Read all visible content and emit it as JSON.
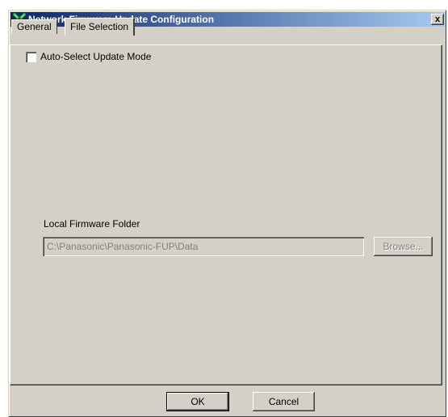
{
  "window": {
    "title": "Network Firmware Update Configuration",
    "icon": "app-icon",
    "close_label": "x"
  },
  "tabs": [
    {
      "label": "General",
      "active": false
    },
    {
      "label": "File Selection",
      "active": true
    }
  ],
  "file_selection": {
    "auto_select_label": "Auto-Select Update Mode",
    "auto_select_checked": false,
    "folder_label": "Local Firmware Folder",
    "folder_path": "C:\\Panasonic\\Panasonic-FUP\\Data",
    "browse_label": "Browse..."
  },
  "buttons": {
    "ok_label": "OK",
    "cancel_label": "Cancel"
  },
  "colors": {
    "titlebar_start": "#0a246a",
    "titlebar_end": "#a6caf0",
    "face": "#d4d0c8"
  }
}
